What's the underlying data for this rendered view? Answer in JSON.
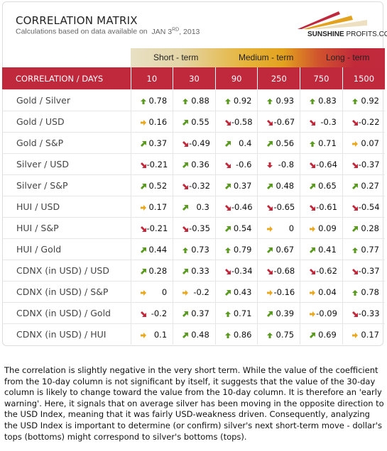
{
  "header": {
    "title": "CORRELATION MATRIX",
    "subtitle_prefix": "Calculations based on data available on",
    "date_month_day": "JAN 3",
    "date_suffix": "RD",
    "date_year": ", 2013",
    "logo_bold": "SUNSHINE",
    "logo_rest": " PROFITS.COM"
  },
  "terms": {
    "short": "Short - term",
    "medium": "Medium - term",
    "long": "Long - term"
  },
  "colors": {
    "header_red": "#c0283c",
    "up_green": "#5a9a1e",
    "down_red": "#c0283c",
    "flat_orange": "#e8a820"
  },
  "table": {
    "corner_label": "CORRELATION / DAYS",
    "columns": [
      "10",
      "30",
      "90",
      "250",
      "750",
      "1500"
    ],
    "rows": [
      {
        "label": "Gold / Silver",
        "cells": [
          {
            "v": "0.78",
            "d": "up"
          },
          {
            "v": "0.88",
            "d": "up"
          },
          {
            "v": "0.92",
            "d": "up"
          },
          {
            "v": "0.93",
            "d": "up"
          },
          {
            "v": "0.83",
            "d": "up"
          },
          {
            "v": "0.92",
            "d": "up"
          }
        ]
      },
      {
        "label": "Gold / USD",
        "cells": [
          {
            "v": "0.16",
            "d": "right"
          },
          {
            "v": "0.55",
            "d": "upright"
          },
          {
            "v": "-0.58",
            "d": "downright"
          },
          {
            "v": "-0.67",
            "d": "downright"
          },
          {
            "v": "-0.3",
            "d": "downright"
          },
          {
            "v": "-0.22",
            "d": "downright"
          }
        ]
      },
      {
        "label": "Gold / S&P",
        "cells": [
          {
            "v": "0.37",
            "d": "upright"
          },
          {
            "v": "-0.49",
            "d": "downright"
          },
          {
            "v": "0.4",
            "d": "upright"
          },
          {
            "v": "0.56",
            "d": "upright"
          },
          {
            "v": "0.71",
            "d": "up"
          },
          {
            "v": "0.07",
            "d": "right"
          }
        ]
      },
      {
        "label": "Silver / USD",
        "cells": [
          {
            "v": "-0.21",
            "d": "downright"
          },
          {
            "v": "0.36",
            "d": "upright"
          },
          {
            "v": "-0.6",
            "d": "downright"
          },
          {
            "v": "-0.8",
            "d": "down"
          },
          {
            "v": "-0.64",
            "d": "downright"
          },
          {
            "v": "-0.37",
            "d": "downright"
          }
        ]
      },
      {
        "label": "Silver / S&P",
        "cells": [
          {
            "v": "0.52",
            "d": "upright"
          },
          {
            "v": "-0.32",
            "d": "downright"
          },
          {
            "v": "0.37",
            "d": "upright"
          },
          {
            "v": "0.48",
            "d": "upright"
          },
          {
            "v": "0.65",
            "d": "upright"
          },
          {
            "v": "0.27",
            "d": "upright"
          }
        ]
      },
      {
        "label": "HUI / USD",
        "cells": [
          {
            "v": "0.17",
            "d": "right"
          },
          {
            "v": "0.3",
            "d": "upright"
          },
          {
            "v": "-0.46",
            "d": "downright"
          },
          {
            "v": "-0.65",
            "d": "downright"
          },
          {
            "v": "-0.61",
            "d": "downright"
          },
          {
            "v": "-0.54",
            "d": "downright"
          }
        ]
      },
      {
        "label": "HUI / S&P",
        "cells": [
          {
            "v": "-0.21",
            "d": "downright"
          },
          {
            "v": "-0.35",
            "d": "downright"
          },
          {
            "v": "0.54",
            "d": "upright"
          },
          {
            "v": "0",
            "d": "right"
          },
          {
            "v": "0.09",
            "d": "right"
          },
          {
            "v": "0.28",
            "d": "upright"
          }
        ]
      },
      {
        "label": "HUI / Gold",
        "cells": [
          {
            "v": "0.44",
            "d": "upright"
          },
          {
            "v": "0.73",
            "d": "up"
          },
          {
            "v": "0.79",
            "d": "up"
          },
          {
            "v": "0.67",
            "d": "upright"
          },
          {
            "v": "0.41",
            "d": "upright"
          },
          {
            "v": "0.77",
            "d": "up"
          }
        ]
      },
      {
        "label": "CDNX (in USD) / USD",
        "cells": [
          {
            "v": "0.28",
            "d": "upright"
          },
          {
            "v": "0.33",
            "d": "upright"
          },
          {
            "v": "-0.34",
            "d": "downright"
          },
          {
            "v": "-0.68",
            "d": "downright"
          },
          {
            "v": "-0.62",
            "d": "downright"
          },
          {
            "v": "-0.37",
            "d": "downright"
          }
        ]
      },
      {
        "label": "CDNX (in USD) / S&P",
        "cells": [
          {
            "v": "0",
            "d": "right"
          },
          {
            "v": "-0.2",
            "d": "right"
          },
          {
            "v": "0.43",
            "d": "upright"
          },
          {
            "v": "-0.16",
            "d": "right"
          },
          {
            "v": "0.04",
            "d": "right"
          },
          {
            "v": "0.78",
            "d": "up"
          }
        ]
      },
      {
        "label": "CDNX (in USD) / Gold",
        "cells": [
          {
            "v": "-0.2",
            "d": "downright"
          },
          {
            "v": "0.37",
            "d": "upright"
          },
          {
            "v": "0.71",
            "d": "up"
          },
          {
            "v": "0.39",
            "d": "upright"
          },
          {
            "v": "-0.09",
            "d": "right"
          },
          {
            "v": "-0.33",
            "d": "downright"
          }
        ]
      },
      {
        "label": "CDNX (in USD) / HUI",
        "cells": [
          {
            "v": "0.1",
            "d": "right"
          },
          {
            "v": "0.48",
            "d": "upright"
          },
          {
            "v": "0.86",
            "d": "up"
          },
          {
            "v": "0.75",
            "d": "up"
          },
          {
            "v": "0.69",
            "d": "upright"
          },
          {
            "v": "0.17",
            "d": "right"
          }
        ]
      }
    ]
  },
  "description": "The correlation is slightly negative in the very short term. While the value of the coefficient from the 10-day column is not significant by itself, it suggests that the value of the 30-day column is likely to change toward the value from the 10-day column. It is therefore an 'early warning'. Here, it signals that on average silver has been moving in the opposite direction to the USD Index, meaning that it was fairly USD-weakness driven. Consequently, analyzing the USD Index is important to determine (or confirm) silver's next short-term move - dollar's tops (bottoms) might correspond to silver's bottoms (tops)."
}
